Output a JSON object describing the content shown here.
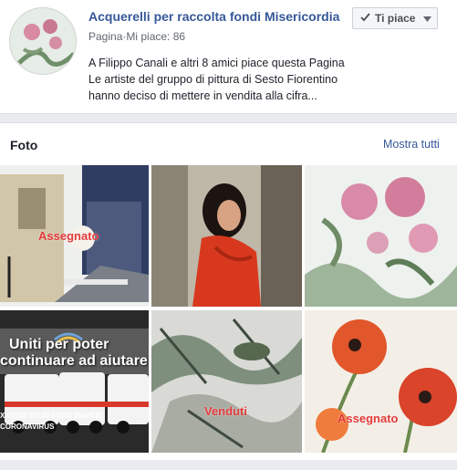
{
  "page": {
    "name": "Acquerelli per raccolta fondi Misericordia",
    "meta": "Pagina·Mi piace: 86",
    "like_button_label": "Ti piace",
    "description_lines": [
      "A Filippo Canali e altri 8 amici piace questa Pagina",
      "Le artiste del gruppo di pittura di Sesto Fiorentino",
      "hanno deciso di mettere in vendita alla cifra..."
    ]
  },
  "photos": {
    "title": "Foto",
    "show_all_label": "Mostra tutti",
    "items": [
      {
        "overlay": "Assegnato"
      },
      {
        "overlay": ""
      },
      {
        "overlay": ""
      },
      {
        "overlay_lines": [
          "Uniti per poter",
          "continuare ad aiutare"
        ],
        "caption": "X 01030 38100 00000 2940630",
        "caption2": "CORONAVIRUS"
      },
      {
        "overlay": "Venduti"
      },
      {
        "overlay": "Assegnato"
      }
    ]
  },
  "colors": {
    "link": "#365899",
    "overlay_red": "#e53b3b",
    "background": "#e9ebee"
  },
  "icons": {
    "like": "checkmark-icon",
    "caret": "chevron-down-icon"
  }
}
